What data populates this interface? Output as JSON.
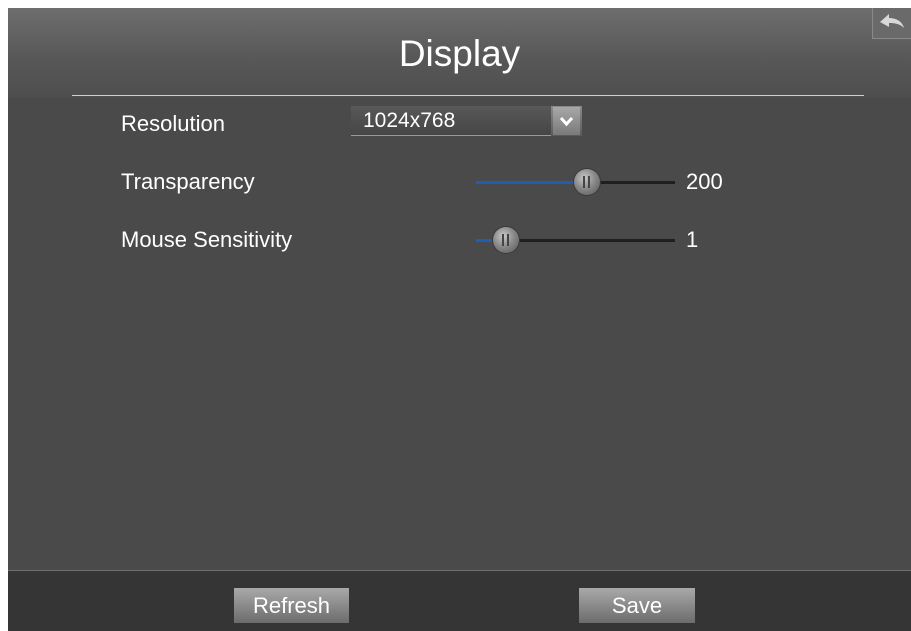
{
  "header": {
    "title": "Display",
    "back_icon": "back-arrow-icon"
  },
  "settings": {
    "resolution": {
      "label": "Resolution",
      "value": "1024x768"
    },
    "transparency": {
      "label": "Transparency",
      "value": "200",
      "fraction": 0.56
    },
    "mouse_sensitivity": {
      "label": "Mouse Sensitivity",
      "value": "1",
      "fraction": 0.15
    }
  },
  "footer": {
    "refresh_label": "Refresh",
    "save_label": "Save"
  },
  "colors": {
    "slider_fill": "#1e5fb4",
    "panel_background": "#4a4a4a"
  }
}
